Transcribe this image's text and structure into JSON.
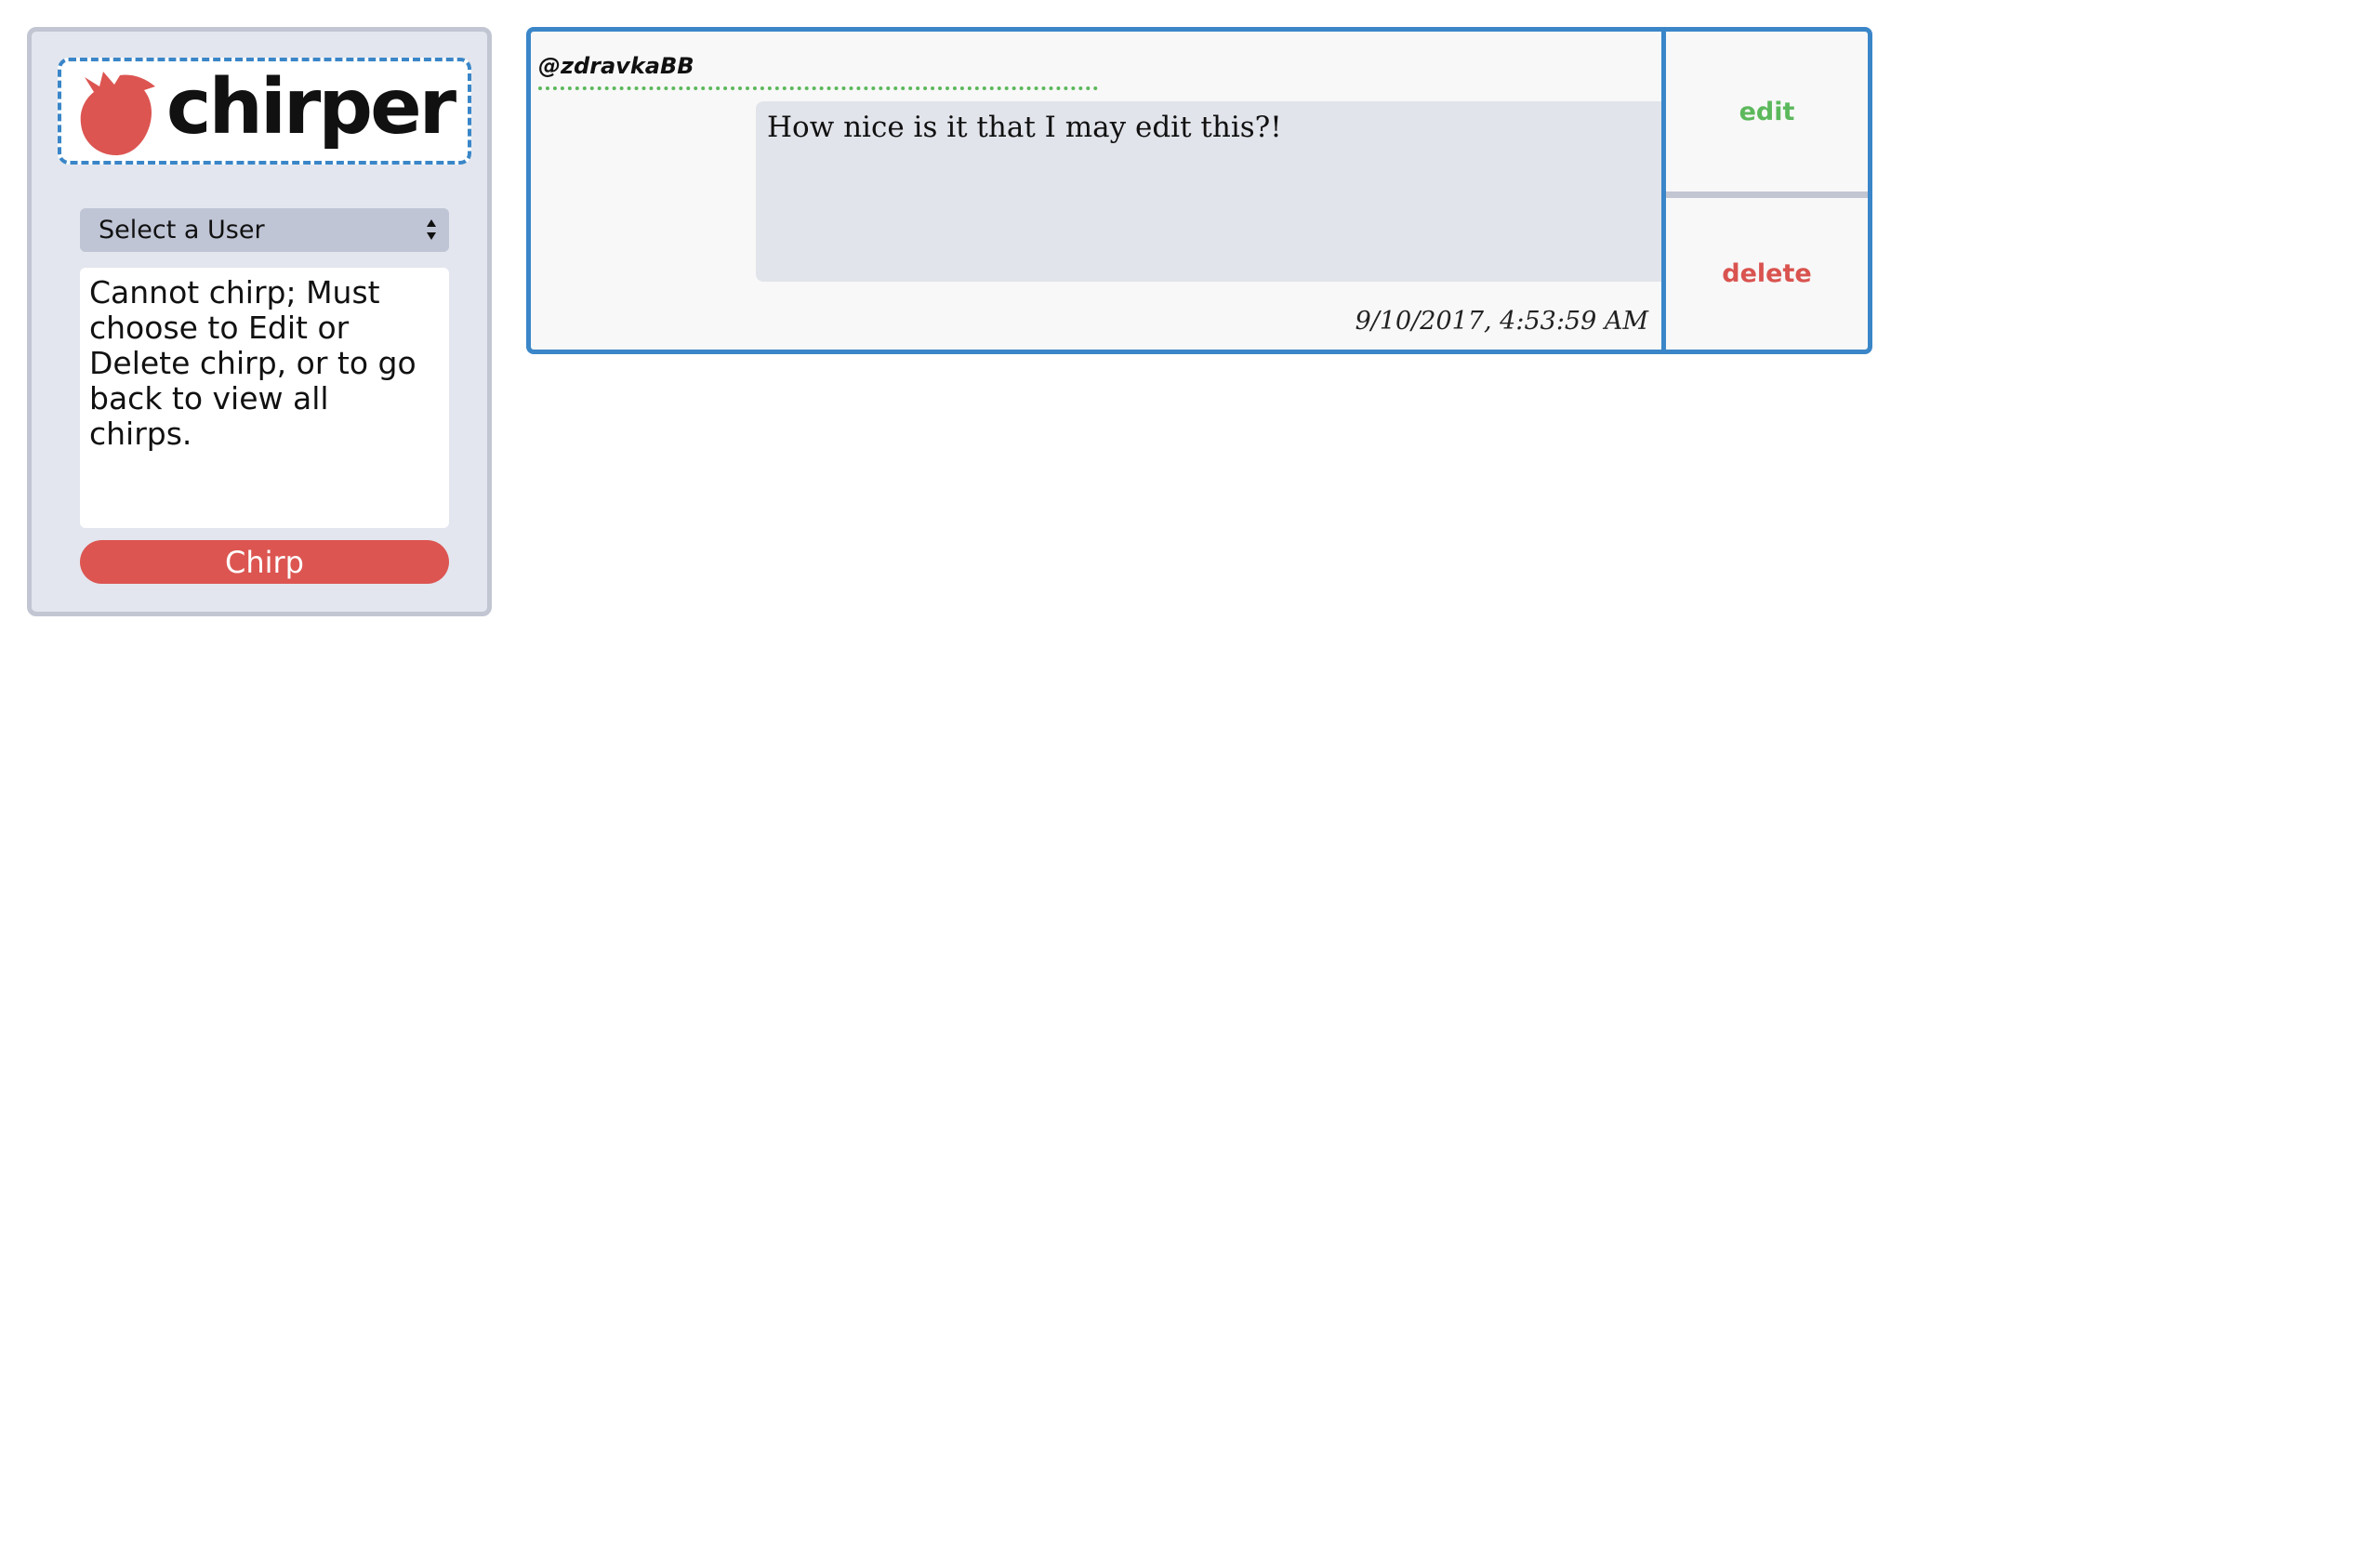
{
  "brand": {
    "name": "chirper",
    "logo_icon": "bird-icon",
    "accent_color": "#dc5551"
  },
  "composer": {
    "user_select": {
      "selected": "Select a User",
      "icon": "select-arrows-icon"
    },
    "textarea_text": "Cannot chirp; Must choose to Edit or Delete chirp, or to go back to view all chirps.",
    "chirp_button_label": "Chirp"
  },
  "chirp": {
    "username": "@zdravkaBB",
    "message": "How nice is it that I may edit this?!",
    "timestamp": "9/10/2017, 4:53:59 AM",
    "actions": {
      "edit_label": "edit",
      "delete_label": "delete"
    }
  },
  "colors": {
    "panel_border": "#3a86c8",
    "edit": "#5cb85c",
    "delete": "#d9534f",
    "sidebar_bg": "#e3e6ee"
  }
}
